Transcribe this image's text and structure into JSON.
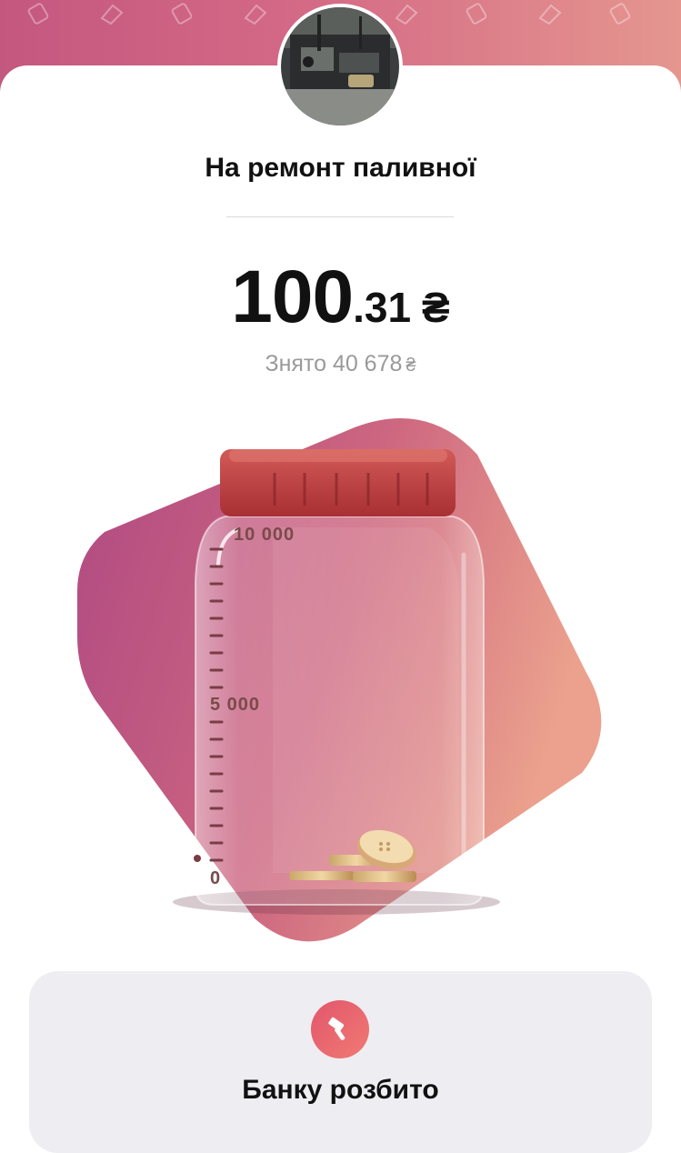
{
  "jar": {
    "title": "На ремонт паливної",
    "balance_integer": "100",
    "balance_fraction": ".31",
    "currency_symbol": "₴",
    "withdrawn_label": "Знято 40 678",
    "withdrawn_currency": "₴",
    "fill_fraction": 0.01
  },
  "scale": {
    "top": "10 000",
    "middle": "5 000",
    "bottom": "0"
  },
  "status": {
    "label": "Банку розбито",
    "icon": "hammer-icon"
  },
  "colors": {
    "header_gradient_start": "#c4577f",
    "header_gradient_end": "#e5968f",
    "jar_lid": "#c0403f",
    "button_accent": "#e2566d"
  }
}
